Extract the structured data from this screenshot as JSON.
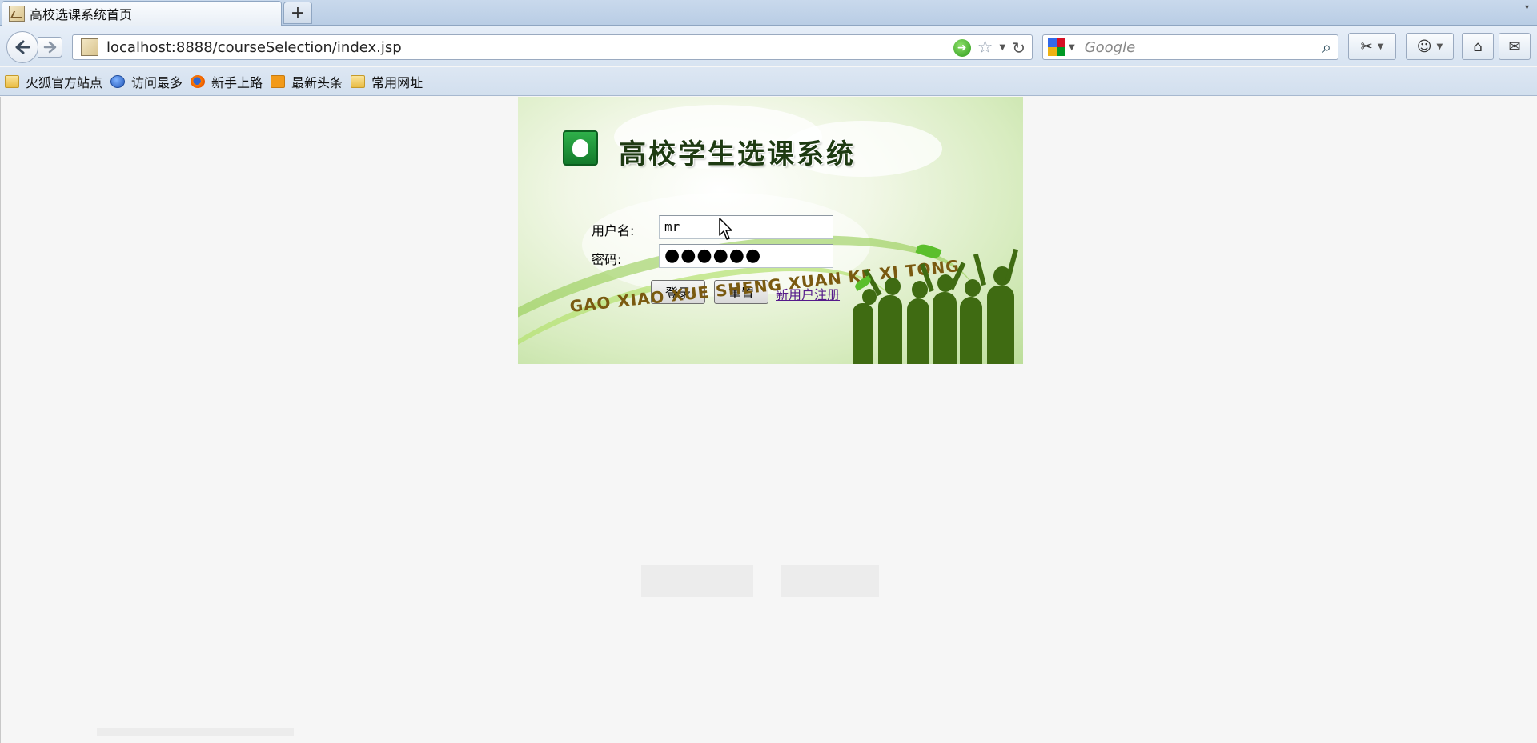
{
  "browser": {
    "tab": {
      "title": "高校选课系统首页"
    },
    "new_tab_label": "+",
    "url": "localhost:8888/courseSelection/index.jsp",
    "search": {
      "placeholder": "Google"
    },
    "bookmarks": [
      {
        "label": "火狐官方站点",
        "icon": "folder-icon"
      },
      {
        "label": "访问最多",
        "icon": "globe-icon"
      },
      {
        "label": "新手上路",
        "icon": "firefox-icon"
      },
      {
        "label": "最新头条",
        "icon": "rss-icon"
      },
      {
        "label": "常用网址",
        "icon": "folder-icon"
      }
    ]
  },
  "login": {
    "system_title": "高校学生选课系统",
    "username_label": "用户名:",
    "username_value": "mr",
    "password_label": "密码:",
    "password_masked": "●●●●●●",
    "login_button": "登录",
    "reset_button": "重置",
    "register_link": "新用户注册",
    "pinyin_banner": "GAO XIAO XUE SHENG XUAN KE XI TONG"
  },
  "colors": {
    "banner_green": "#bcde9a",
    "title_text": "#1e3a12",
    "visited_link": "#551a8b",
    "silhouette": "#3f6b12"
  }
}
